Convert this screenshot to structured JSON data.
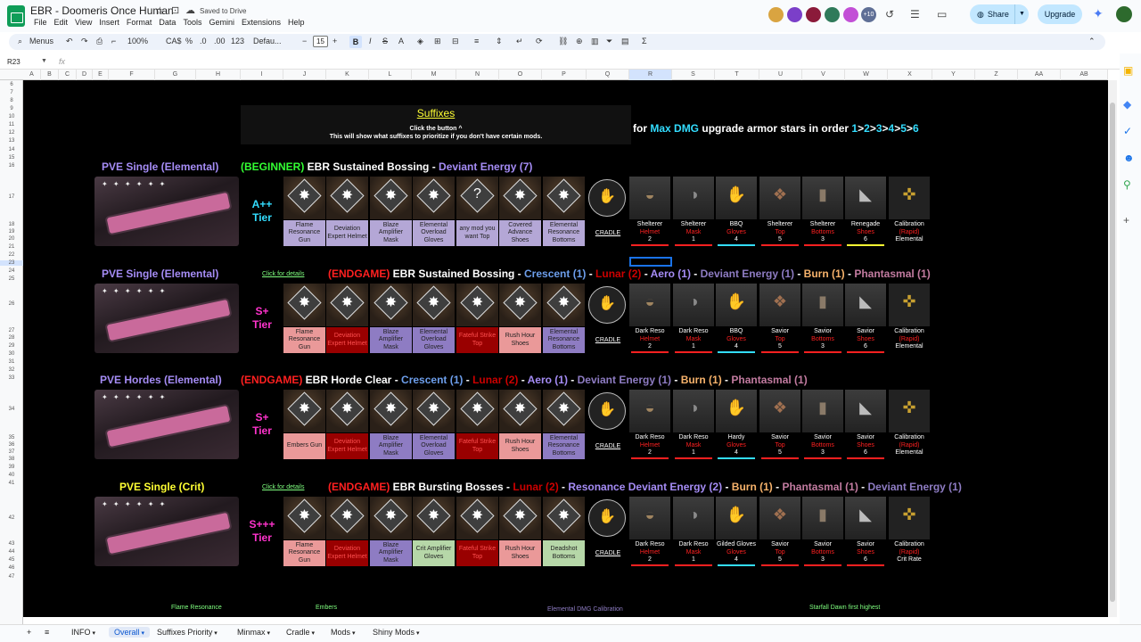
{
  "doc": {
    "title": "EBR - Doomeris Once Human",
    "saved": "Saved to Drive"
  },
  "menu": [
    "File",
    "Edit",
    "View",
    "Insert",
    "Format",
    "Data",
    "Tools",
    "Gemini",
    "Extensions",
    "Help"
  ],
  "topbar": {
    "avatar_count": "+10",
    "share": "Share",
    "upgrade": "Upgrade"
  },
  "toolbar": {
    "menus": "Menus",
    "zoom": "100%",
    "currency": "CA$",
    "percent": "%",
    "dec": ".0",
    "dec2": ".00",
    "num": "123",
    "font": "Defau...",
    "size": "15"
  },
  "formula": {
    "namebox": "R23",
    "fx": "fx"
  },
  "columns": [
    "A",
    "B",
    "C",
    "D",
    "E",
    "F",
    "G",
    "H",
    "I",
    "J",
    "K",
    "L",
    "M",
    "N",
    "O",
    "P",
    "Q",
    "R",
    "S",
    "T",
    "U",
    "V",
    "W",
    "X",
    "Y",
    "Z",
    "AA",
    "AB"
  ],
  "rows": [
    "6",
    "7",
    "8",
    "9",
    "10",
    "11",
    "12",
    "13",
    "14",
    "15",
    "16",
    "17",
    "18",
    "19",
    "20",
    "21",
    "22",
    "23",
    "24",
    "25",
    "26",
    "27",
    "28",
    "29",
    "30",
    "31",
    "32",
    "33",
    "34",
    "35",
    "36",
    "37",
    "38",
    "39",
    "40",
    "41",
    "42",
    "43",
    "44",
    "45",
    "46",
    "47"
  ],
  "colors": {
    "green": "#33ff33",
    "yellow": "#ffff33",
    "purple": "#a58cf5",
    "red": "#ff2020",
    "pink": "#ff33cc",
    "cyan": "#33ddff"
  },
  "suffixes": {
    "title": "Suffixes",
    "sub1": "Click the button ^",
    "sub2": "This will show what suffixes to prioritize if you don't have certain mods."
  },
  "maxdmg": {
    "pre": "for ",
    "hl": "Max DMG",
    "mid": " upgrade armor stars in order ",
    "n1": "1",
    ">1": ">",
    "n2": "2",
    ">2": ">",
    "n3": "3",
    ">3": ">",
    "n4": "4",
    ">4": ">",
    "n5": "5",
    ">5": ">",
    "n6": "6"
  },
  "builds": [
    {
      "title": "PVE Single (Elemental)",
      "link": "",
      "level": "(BEGINNER)",
      "desc_parts": [
        {
          "t": " EBR Sustained Bossing - ",
          "c": "#ffffff"
        },
        {
          "t": "Deviant Energy (7)",
          "c": "#a58cf5"
        }
      ],
      "tier": "A++ Tier",
      "tier_color": "#33ddff",
      "stars": "✦ ✦ ✦ ✦ ✦ ✦",
      "mods": [
        {
          "label": "Flame Resonance Gun",
          "bg": "#b4a7d6",
          "g": "✸"
        },
        {
          "label": "Deviation Expert Helmet",
          "bg": "#b4a7d6",
          "g": "✸"
        },
        {
          "label": "Blaze Amplifier Mask",
          "bg": "#b4a7d6",
          "g": "✸"
        },
        {
          "label": "Elemental Overload Gloves",
          "bg": "#b4a7d6",
          "g": "✸"
        },
        {
          "label": "any mod you want Top",
          "bg": "#b4a7d6",
          "g": "?"
        },
        {
          "label": "Covered Advance Shoes",
          "bg": "#b4a7d6",
          "g": "✸"
        },
        {
          "label": "Elemental Resonance Bottoms",
          "bg": "#b4a7d6",
          "g": "✸"
        }
      ],
      "cradle": "CRADLE",
      "armor": [
        {
          "n": "Shelterer",
          "s": "Helmet",
          "v": "2",
          "bar": "#ff2020"
        },
        {
          "n": "Shelterer",
          "s": "Mask",
          "v": "1",
          "bar": "#ff2020"
        },
        {
          "n": "BBQ",
          "s": "Gloves",
          "v": "4",
          "bar": "#33ddff"
        },
        {
          "n": "Shelterer",
          "s": "Top",
          "v": "5",
          "bar": "#ff2020"
        },
        {
          "n": "Shelterer",
          "s": "Bottoms",
          "v": "3",
          "bar": "#ff2020"
        },
        {
          "n": "Renegade",
          "s": "Shoes",
          "v": "6",
          "bar": "#ffff33"
        },
        {
          "n": "Calibration",
          "s": "(Rapid)",
          "v": "Elemental",
          "bar": "#000"
        }
      ]
    },
    {
      "title": "PVE Single (Elemental)",
      "link": "Click for details",
      "level": "(ENDGAME)",
      "desc_parts": [
        {
          "t": " EBR Sustained Bossing - ",
          "c": "#ffffff"
        },
        {
          "t": "Crescent (1)",
          "c": "#6d9eeb"
        },
        {
          "t": " - ",
          "c": "#ffffff"
        },
        {
          "t": "Lunar (2)",
          "c": "#cc0000"
        },
        {
          "t": " - ",
          "c": "#ffffff"
        },
        {
          "t": "Aero (1)",
          "c": "#a58cf5"
        },
        {
          "t": " - ",
          "c": "#ffffff"
        },
        {
          "t": "Deviant Energy (1)",
          "c": "#8e7cc3"
        },
        {
          "t": " - ",
          "c": "#ffffff"
        },
        {
          "t": "Burn (1)",
          "c": "#f6b26b"
        },
        {
          "t": " - ",
          "c": "#ffffff"
        },
        {
          "t": "Phantasmal (1)",
          "c": "#c27ba0"
        }
      ],
      "tier": "S+ Tier",
      "tier_color": "#ff33cc",
      "stars": "✦ ✦ ✦ ✦ ✦ ✦",
      "mods": [
        {
          "label": "Flame Resonance Gun",
          "bg": "#ea9999",
          "g": "✸"
        },
        {
          "label": "Deviation Expert Helmet",
          "bg": "#990000",
          "g": "✸"
        },
        {
          "label": "Blaze Amplifier Mask",
          "bg": "#8e7cc3",
          "g": "✸"
        },
        {
          "label": "Elemental Overload Gloves",
          "bg": "#8e7cc3",
          "g": "✸"
        },
        {
          "label": "Fateful Strike Top",
          "bg": "#990000",
          "g": "✸"
        },
        {
          "label": "Rush Hour Shoes",
          "bg": "#ea9999",
          "g": "✸"
        },
        {
          "label": "Elemental Resonance Bottoms",
          "bg": "#8e7cc3",
          "g": "✸"
        }
      ],
      "cradle": "CRADLE",
      "armor": [
        {
          "n": "Dark Reso",
          "s": "Helmet",
          "v": "2",
          "bar": "#ff2020"
        },
        {
          "n": "Dark Reso",
          "s": "Mask",
          "v": "1",
          "bar": "#ff2020"
        },
        {
          "n": "BBQ",
          "s": "Gloves",
          "v": "4",
          "bar": "#33ddff"
        },
        {
          "n": "Savior",
          "s": "Top",
          "v": "5",
          "bar": "#ff2020"
        },
        {
          "n": "Savior",
          "s": "Bottoms",
          "v": "3",
          "bar": "#ff2020"
        },
        {
          "n": "Savior",
          "s": "Shoes",
          "v": "6",
          "bar": "#ff2020"
        },
        {
          "n": "Calibration",
          "s": "(Rapid)",
          "v": "Elemental",
          "bar": "#000"
        }
      ]
    },
    {
      "title": "PVE Hordes (Elemental)",
      "link": "",
      "level": "(ENDGAME)",
      "desc_parts": [
        {
          "t": " EBR Horde Clear - ",
          "c": "#ffffff"
        },
        {
          "t": "Crescent (1)",
          "c": "#6d9eeb"
        },
        {
          "t": " - ",
          "c": "#ffffff"
        },
        {
          "t": "Lunar (2)",
          "c": "#cc0000"
        },
        {
          "t": " - ",
          "c": "#ffffff"
        },
        {
          "t": "Aero (1)",
          "c": "#a58cf5"
        },
        {
          "t": " - ",
          "c": "#ffffff"
        },
        {
          "t": "Deviant Energy (1)",
          "c": "#8e7cc3"
        },
        {
          "t": " - ",
          "c": "#ffffff"
        },
        {
          "t": "Burn (1)",
          "c": "#f6b26b"
        },
        {
          "t": " - ",
          "c": "#ffffff"
        },
        {
          "t": "Phantasmal (1)",
          "c": "#c27ba0"
        }
      ],
      "tier": "S+ Tier",
      "tier_color": "#ff33cc",
      "stars": "✦ ✦ ✦ ✦ ✦ ✦",
      "mods": [
        {
          "label": "Embers Gun",
          "bg": "#ea9999",
          "g": "✸"
        },
        {
          "label": "Deviation Expert Helmet",
          "bg": "#990000",
          "g": "✸"
        },
        {
          "label": "Blaze Amplifier Mask",
          "bg": "#8e7cc3",
          "g": "✸"
        },
        {
          "label": "Elemental Overload Gloves",
          "bg": "#8e7cc3",
          "g": "✸"
        },
        {
          "label": "Fateful Strike Top",
          "bg": "#990000",
          "g": "✸"
        },
        {
          "label": "Rush Hour Shoes",
          "bg": "#ea9999",
          "g": "✸"
        },
        {
          "label": "Elemental Resonance Bottoms",
          "bg": "#8e7cc3",
          "g": "✸"
        }
      ],
      "cradle": "CRADLE",
      "armor": [
        {
          "n": "Dark Reso",
          "s": "Helmet",
          "v": "2",
          "bar": "#ff2020"
        },
        {
          "n": "Dark Reso",
          "s": "Mask",
          "v": "1",
          "bar": "#ff2020"
        },
        {
          "n": "Hardy",
          "s": "Gloves",
          "v": "4",
          "bar": "#33ddff"
        },
        {
          "n": "Savior",
          "s": "Top",
          "v": "5",
          "bar": "#ff2020"
        },
        {
          "n": "Savior",
          "s": "Bottoms",
          "v": "3",
          "bar": "#ff2020"
        },
        {
          "n": "Savior",
          "s": "Shoes",
          "v": "6",
          "bar": "#ff2020"
        },
        {
          "n": "Calibration",
          "s": "(Rapid)",
          "v": "Elemental",
          "bar": "#000"
        }
      ]
    },
    {
      "title": "PVE Single (Crit)",
      "link": "Click for details",
      "level": "(ENDGAME)",
      "desc_parts": [
        {
          "t": " EBR Bursting Bosses - ",
          "c": "#ffffff"
        },
        {
          "t": "Lunar (2)",
          "c": "#cc0000"
        },
        {
          "t": " - ",
          "c": "#ffffff"
        },
        {
          "t": "Resonance Deviant Energy (2)",
          "c": "#a58cf5"
        },
        {
          "t": " - ",
          "c": "#ffffff"
        },
        {
          "t": "Burn (1)",
          "c": "#f6b26b"
        },
        {
          "t": " - ",
          "c": "#ffffff"
        },
        {
          "t": "Phantasmal (1)",
          "c": "#c27ba0"
        },
        {
          "t": " - ",
          "c": "#ffffff"
        },
        {
          "t": "Deviant Energy (1)",
          "c": "#8e7cc3"
        }
      ],
      "tier": "S+++ Tier",
      "tier_color": "#ff33cc",
      "stars": "✦ ✦ ✦ ✦ ✦ ✦",
      "mods": [
        {
          "label": "Flame Resonance Gun",
          "bg": "#ea9999",
          "g": "✸"
        },
        {
          "label": "Deviation Expert Helmet",
          "bg": "#990000",
          "g": "✸"
        },
        {
          "label": "Blaze Amplifier Mask",
          "bg": "#8e7cc3",
          "g": "✸"
        },
        {
          "label": "Crit Amplifier Gloves",
          "bg": "#b6d7a8",
          "g": "✸"
        },
        {
          "label": "Fateful Strike Top",
          "bg": "#990000",
          "g": "✸"
        },
        {
          "label": "Rush Hour Shoes",
          "bg": "#ea9999",
          "g": "✸"
        },
        {
          "label": "Deadshot Bottoms",
          "bg": "#b6d7a8",
          "g": "✸"
        }
      ],
      "cradle": "CRADLE",
      "armor": [
        {
          "n": "Dark Reso",
          "s": "Helmet",
          "v": "2",
          "bar": "#ff2020"
        },
        {
          "n": "Dark Reso",
          "s": "Mask",
          "v": "1",
          "bar": "#ff2020"
        },
        {
          "n": "Gilded Gloves",
          "s": "Gloves",
          "v": "4",
          "bar": "#33ddff"
        },
        {
          "n": "Savior",
          "s": "Top",
          "v": "5",
          "bar": "#ff2020"
        },
        {
          "n": "Savior",
          "s": "Bottoms",
          "v": "3",
          "bar": "#ff2020"
        },
        {
          "n": "Savior",
          "s": "Shoes",
          "v": "6",
          "bar": "#ff2020"
        },
        {
          "n": "Calibration",
          "s": "(Rapid)",
          "v": "Crit Rate",
          "bar": "#000"
        }
      ]
    }
  ],
  "bottom": {
    "a": "Flame Resonance",
    "b": "Embers",
    "c": "Elemental DMG Calibration",
    "d": "Starfall Dawn first highest"
  },
  "tabs": [
    "INFO",
    "Overall",
    "Suffixes Priority",
    "Minmax",
    "Cradle",
    "Mods",
    "Shiny Mods"
  ],
  "active_tab": "Overall"
}
